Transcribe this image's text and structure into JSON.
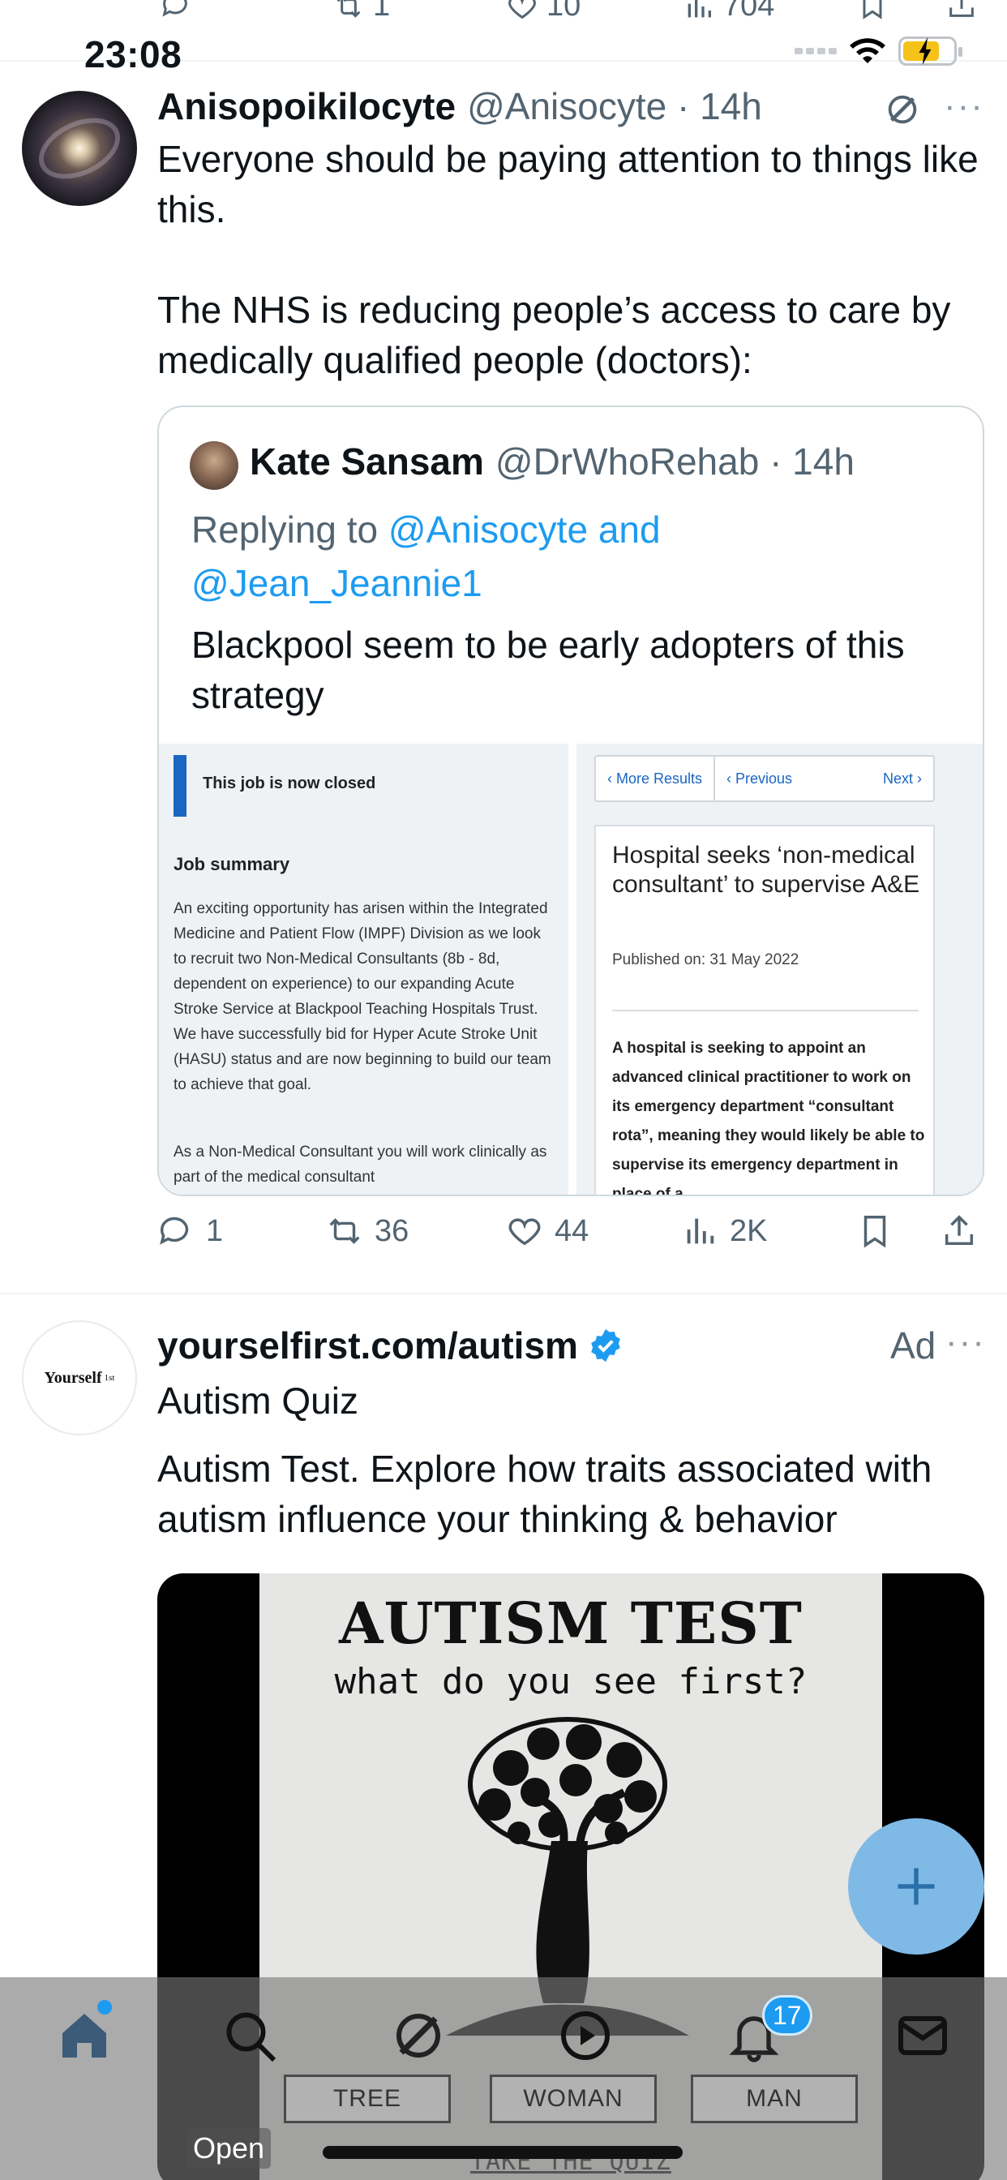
{
  "status_bar": {
    "time": "23:08"
  },
  "prev_tweet_actions": {
    "retweets": "1",
    "likes": "10",
    "views": "704"
  },
  "tweet": {
    "author_name": "Anisopoikilocyte",
    "handle_time": "@Anisocyte · 14h",
    "text": "Everyone should be paying attention to things like this.\n\nThe NHS is reducing people’s access to care by medically qualified people (doctors):",
    "quote": {
      "author_name": "Kate Sansam",
      "handle_time": "@DrWhoRehab · 14h",
      "replying_prefix": "Replying to ",
      "replying_links": "@Anisocyte and @Jean_Jeannie1",
      "text": "Blackpool seem to be early adopters of this strategy",
      "image_left": {
        "banner": "This job is now closed",
        "heading": "Job summary",
        "para1": "An exciting opportunity has arisen within the Integrated Medicine and Patient Flow (IMPF) Division as we look to recruit two Non-Medical Consultants (8b - 8d, dependent on experience) to our expanding Acute Stroke Service at Blackpool Teaching Hospitals Trust. We have successfully bid for Hyper Acute Stroke Unit (HASU) status and are now beginning to build our team to achieve that goal.",
        "para2": "As a Non-Medical Consultant you will work clinically as part of the medical consultant"
      },
      "image_right": {
        "nav_more": "‹  More Results",
        "nav_prev": "‹  Previous",
        "nav_next": "Next  ›",
        "headline": "Hospital seeks ‘non-medical consultant’ to supervise A&E",
        "published": "Published on: 31 May 2022",
        "lede": "A hospital is seeking to appoint an advanced clinical practitioner to work on its emergency department “consultant rota”, meaning they would likely be able to supervise its emergency department in place of a"
      }
    },
    "actions": {
      "replies": "1",
      "retweets": "36",
      "likes": "44",
      "views": "2K"
    }
  },
  "ad": {
    "avatar_text": "Yourself",
    "avatar_sup": "1st",
    "domain": "yourselfirst.com/autism",
    "label": "Ad",
    "title": "Autism Quiz",
    "text": "Autism Test. Explore how traits associated with autism influence your thinking & behavior",
    "media": {
      "heading": "AUTISM TEST",
      "subheading": "what do you see first?",
      "choices": [
        "TREE",
        "WOMAN",
        "MAN"
      ],
      "cta": "TAKE THE QUIZ",
      "open_label": "Open"
    }
  },
  "tabbar": {
    "notifications_badge": "17"
  },
  "colors": {
    "accent": "#1d9bf0",
    "text": "#0f1419",
    "secondary": "#536471"
  }
}
